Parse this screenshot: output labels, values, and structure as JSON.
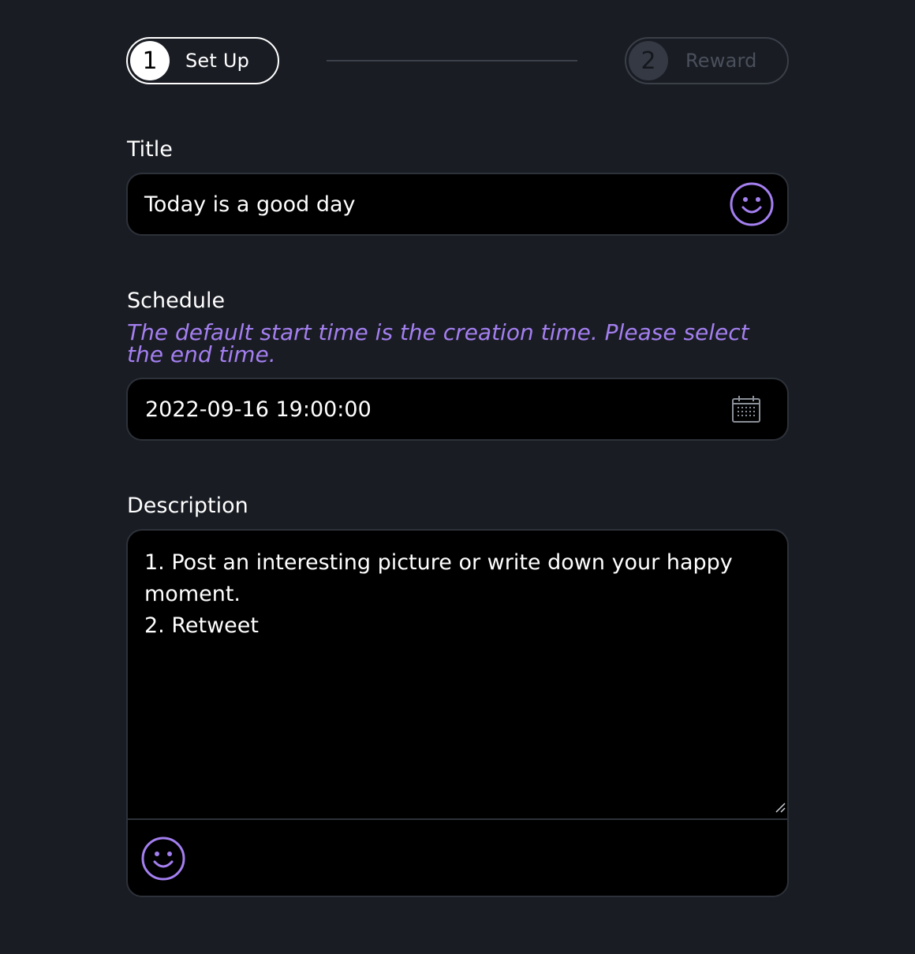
{
  "stepper": {
    "steps": [
      {
        "number": "1",
        "label": "Set Up",
        "state": "active"
      },
      {
        "number": "2",
        "label": "Reward",
        "state": "inactive"
      }
    ]
  },
  "form": {
    "title": {
      "label": "Title",
      "value": "Today is a good day",
      "icon": "smile-emoji-icon"
    },
    "schedule": {
      "label": "Schedule",
      "hint": "The default start time is the creation time. Please select the end time.",
      "value": "2022-09-16 19:00:00",
      "icon": "calendar-icon"
    },
    "description": {
      "label": "Description",
      "lines": [
        "1. Post an interesting picture or write down your happy",
        "moment.",
        "2. Retweet"
      ],
      "icon": "smile-emoji-icon"
    }
  },
  "colors": {
    "background": "#191c23",
    "field_background": "#000000",
    "accent": "#a47ff0",
    "field_border": "#2d3139",
    "inactive": "#4a505b"
  }
}
